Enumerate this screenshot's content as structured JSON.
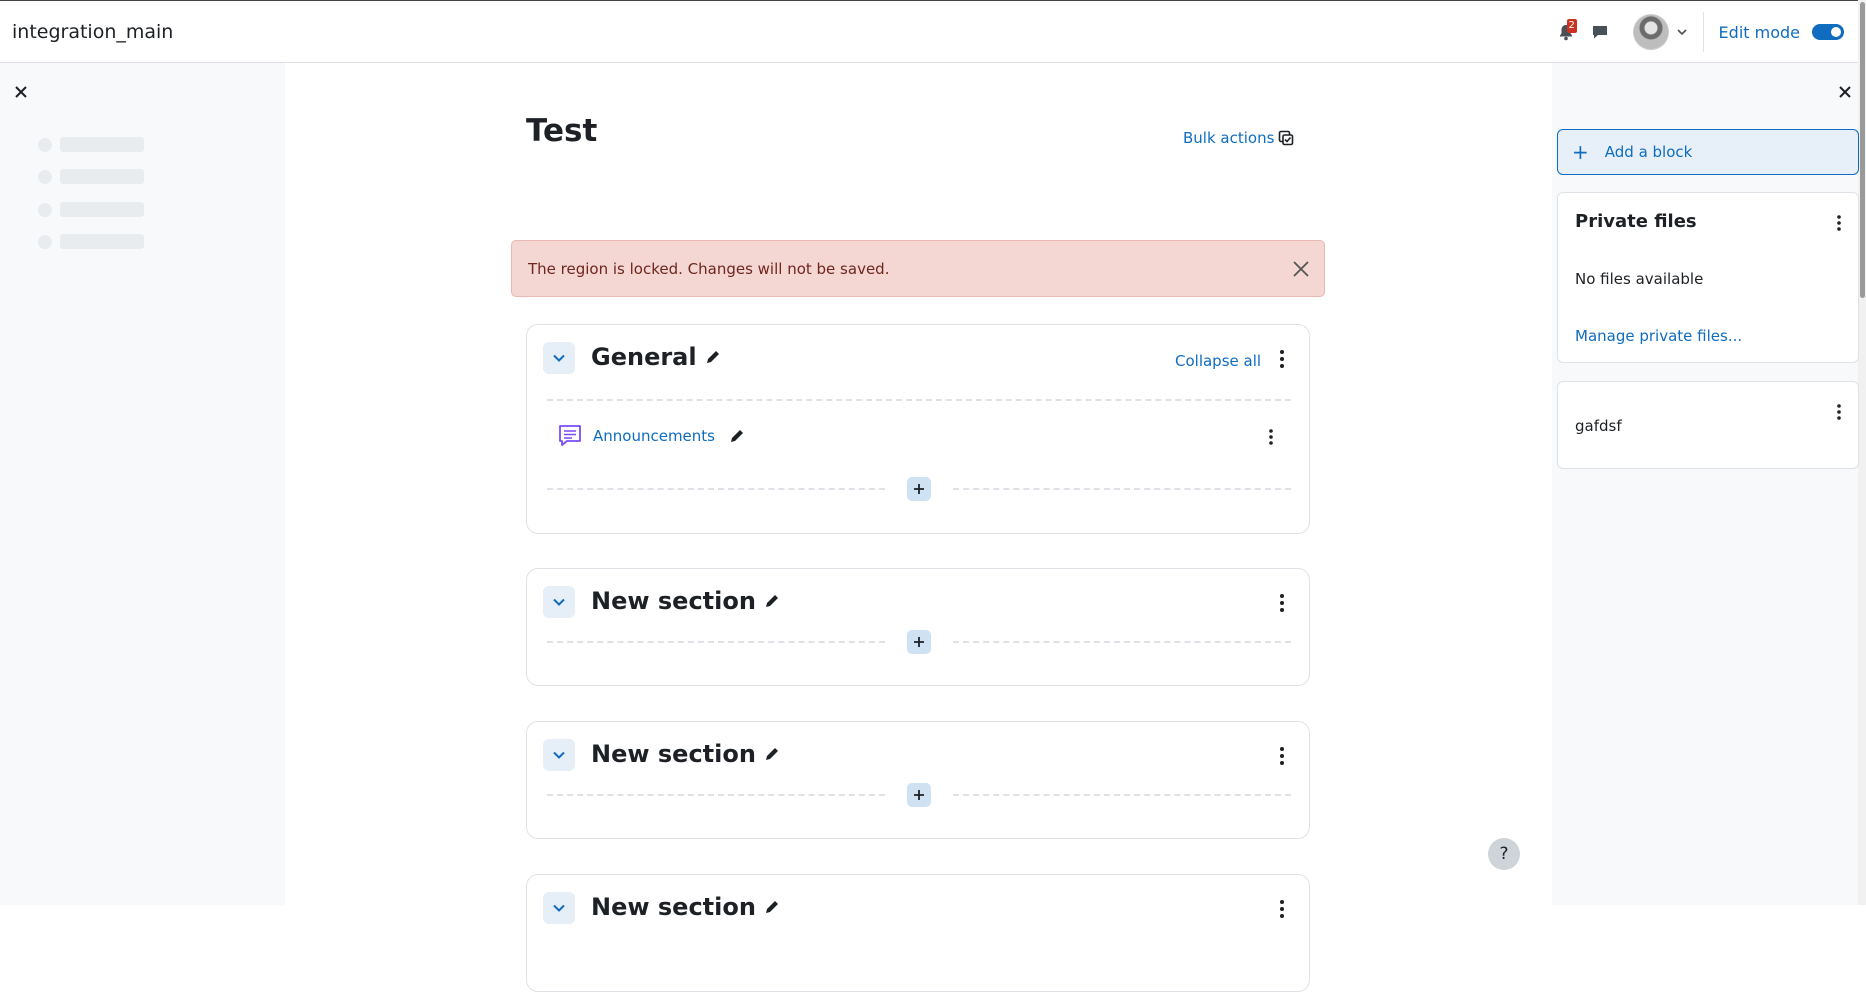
{
  "navbar": {
    "site_name": "integration_main",
    "notification_count": "2",
    "edit_mode_label": "Edit mode",
    "edit_mode_on": true
  },
  "course": {
    "title": "Test",
    "bulk_actions_label": "Bulk actions"
  },
  "alert": {
    "message": "The region is locked. Changes will not be saved."
  },
  "sections": [
    {
      "title": "General",
      "collapse_all_label": "Collapse all",
      "activities": [
        {
          "name": "Announcements",
          "icon": "forum-icon"
        }
      ]
    },
    {
      "title": "New section",
      "activities": []
    },
    {
      "title": "New section",
      "activities": []
    },
    {
      "title": "New section",
      "activities": []
    }
  ],
  "help": {
    "label": "?"
  },
  "right_drawer": {
    "add_block_label": "Add a block",
    "blocks": [
      {
        "title": "Private files",
        "text": "No files available",
        "link": "Manage private files..."
      },
      {
        "text": "gafdsf"
      }
    ]
  },
  "colors": {
    "primary": "#0f6cbf",
    "alert_bg": "#f4d6d2",
    "alert_text": "#6e261e",
    "badge": "#ca3120",
    "drawer_bg": "#f8f9fa"
  }
}
